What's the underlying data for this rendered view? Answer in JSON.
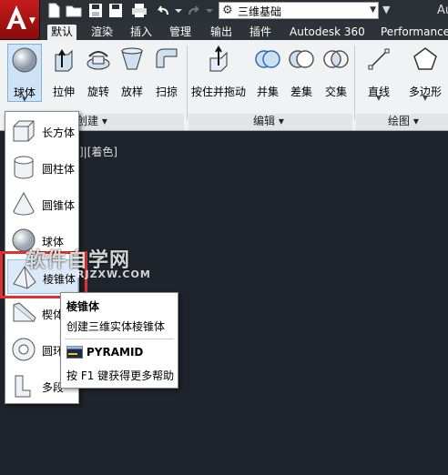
{
  "app": {
    "logo_letter": "A",
    "workspace": "三维基础",
    "title_partial": "Au"
  },
  "tabs": [
    "默认",
    "渲染",
    "插入",
    "管理",
    "输出",
    "插件",
    "Autodesk 360",
    "Performance"
  ],
  "ribbon": {
    "buttons": [
      {
        "label": "球体",
        "icon": "sphere-icon"
      },
      {
        "label": "拉伸",
        "icon": "extrude-icon"
      },
      {
        "label": "旋转",
        "icon": "revolve-icon"
      },
      {
        "label": "放样",
        "icon": "loft-icon"
      },
      {
        "label": "扫掠",
        "icon": "sweep-icon"
      },
      {
        "label": "按住并拖动",
        "icon": "presspull-icon"
      },
      {
        "label": "并集",
        "icon": "union-icon"
      },
      {
        "label": "差集",
        "icon": "subtract-icon"
      },
      {
        "label": "交集",
        "icon": "intersect-icon"
      },
      {
        "label": "直线",
        "icon": "line-icon"
      },
      {
        "label": "多边形",
        "icon": "polygon-icon"
      }
    ],
    "panels": {
      "create": "创建 ▾",
      "edit": "编辑 ▾",
      "draw": "绘图 ▾"
    }
  },
  "viewport_label": "]|[着色]",
  "dropdown": [
    {
      "label": "长方体",
      "icon": "box-icon"
    },
    {
      "label": "圆柱体",
      "icon": "cylinder-icon"
    },
    {
      "label": "圆锥体",
      "icon": "cone-icon"
    },
    {
      "label": "球体",
      "icon": "sphere-icon"
    },
    {
      "label": "棱锥体",
      "icon": "pyramid-icon"
    },
    {
      "label": "楔体",
      "icon": "wedge-icon"
    },
    {
      "label": "圆环",
      "icon": "torus-icon"
    },
    {
      "label": "多段",
      "icon": "polysolid-icon"
    }
  ],
  "tooltip": {
    "title": "棱锥体",
    "description": "创建三维实体棱锥体",
    "command": "PYRAMID",
    "help": "按 F1 键获得更多帮助"
  },
  "watermark": {
    "main": "软件自学网",
    "sub": "RJZXW.COM"
  }
}
